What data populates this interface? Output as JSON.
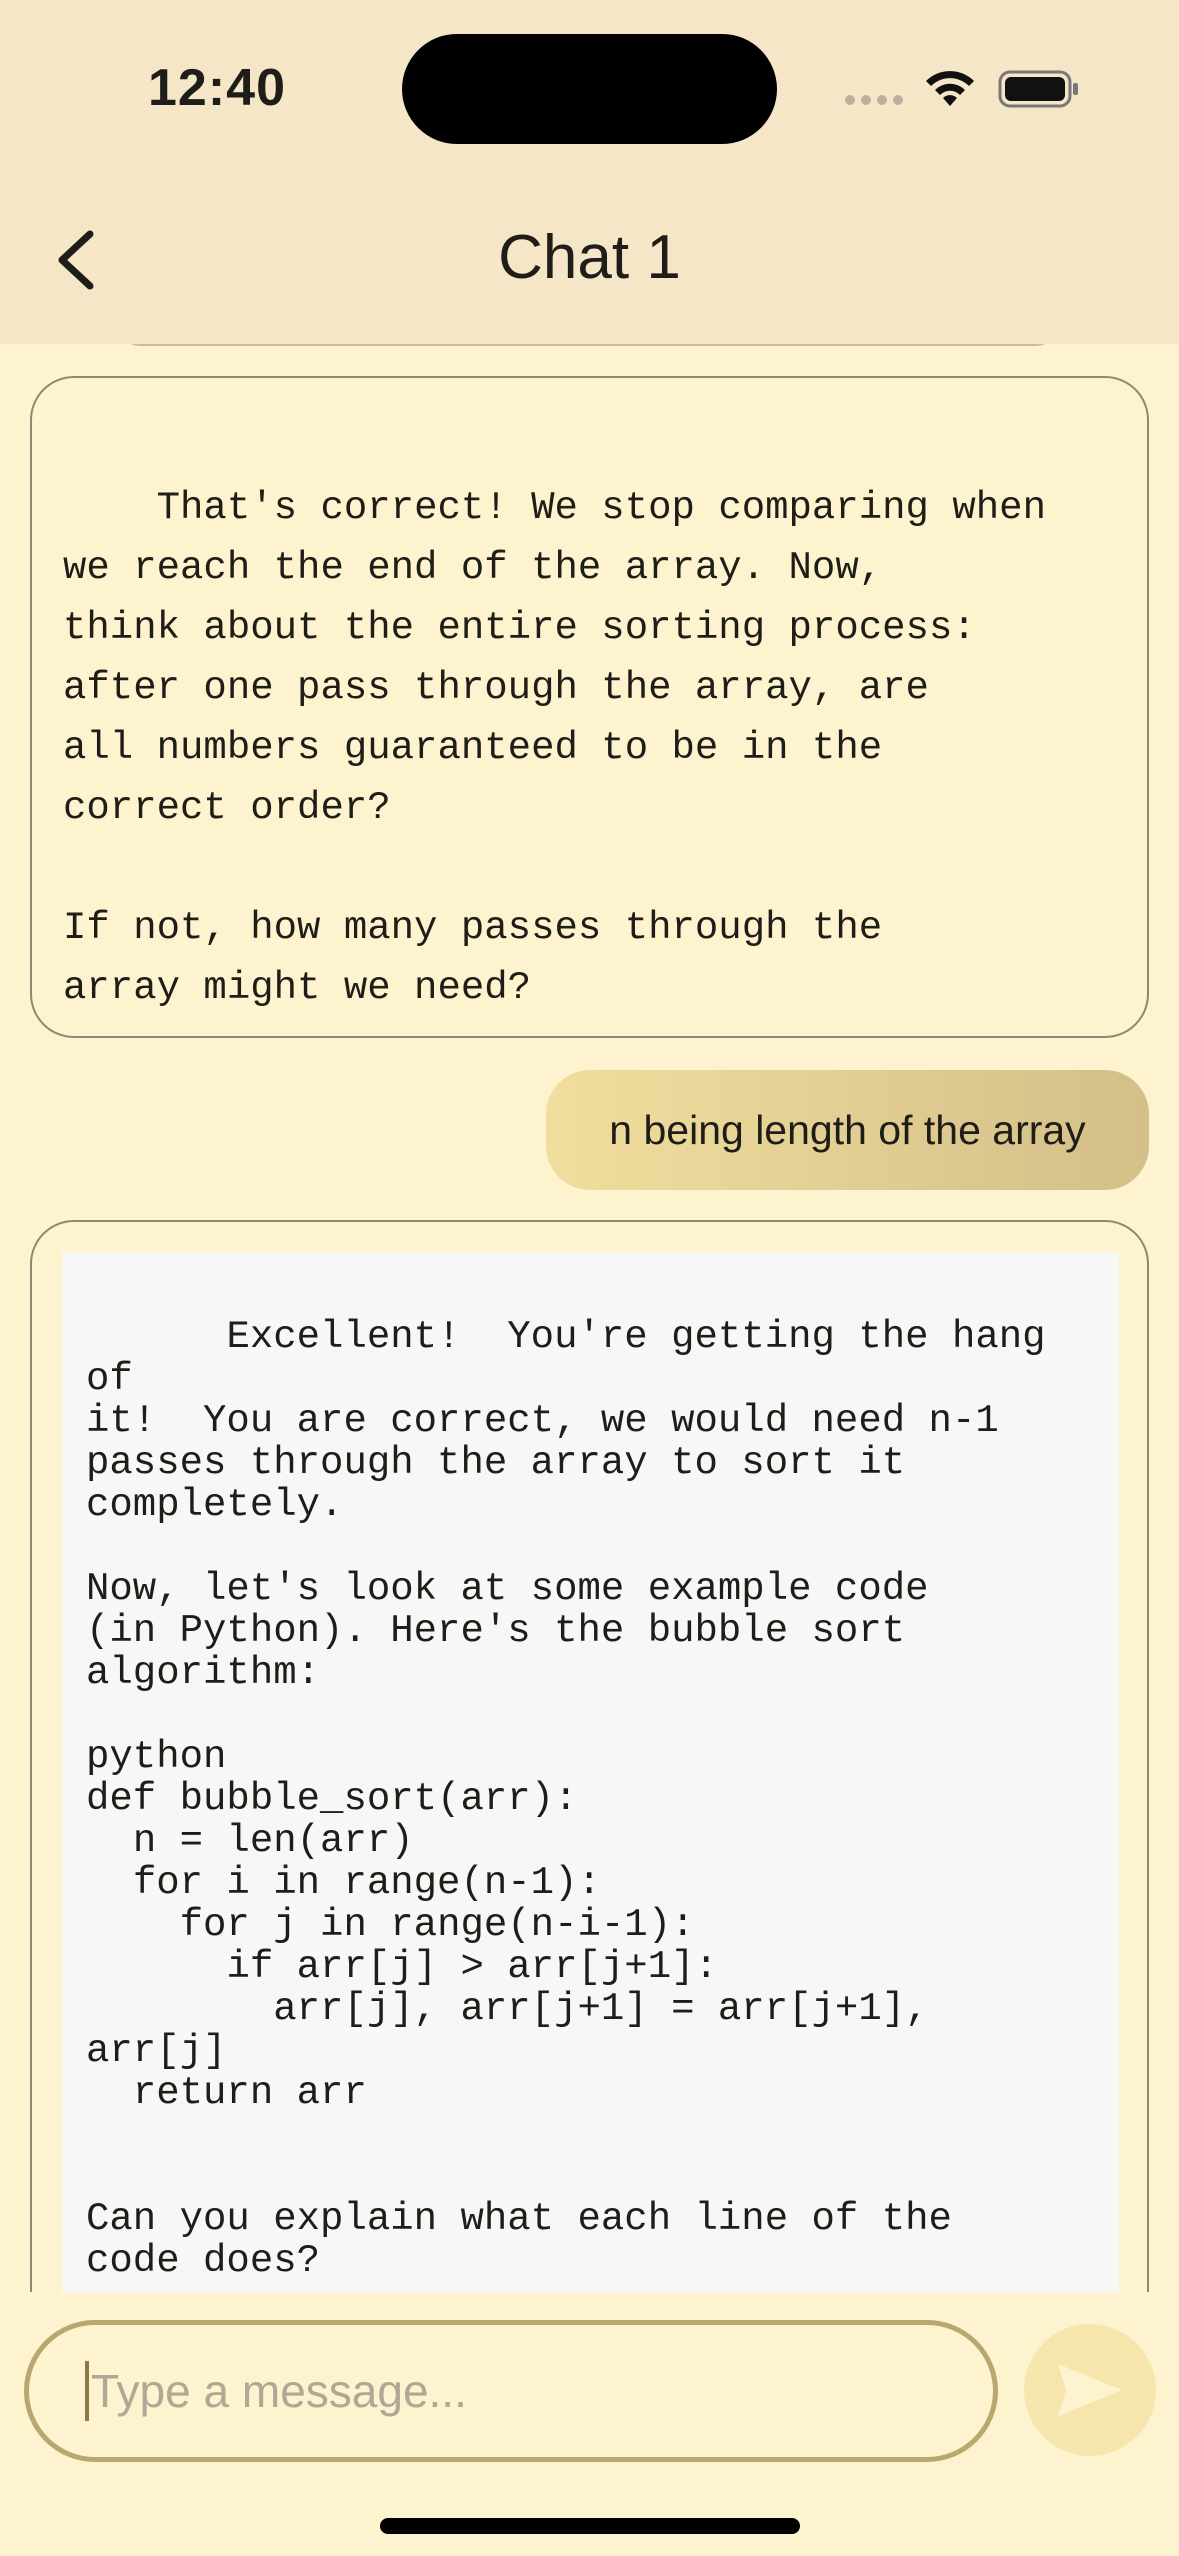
{
  "status_bar": {
    "time": "12:40",
    "icons": [
      "signal-dots-icon",
      "wifi-icon",
      "battery-icon"
    ]
  },
  "header": {
    "back_icon": "chevron-left-icon",
    "title": "Chat 1"
  },
  "messages": [
    {
      "role": "assistant",
      "text": "That's correct! We stop comparing when\nwe reach the end of the array. Now,\nthink about the entire sorting process:\nafter one pass through the array, are\nall numbers guaranteed to be in the\ncorrect order?\n\nIf not, how many passes through the\narray might we need?"
    },
    {
      "role": "user",
      "text": "n being length of the array"
    },
    {
      "role": "assistant",
      "text": "Excellent!  You're getting the hang of\nit!  You are correct, we would need n-1\npasses through the array to sort it\ncompletely.\n\nNow, let's look at some example code\n(in Python). Here's the bubble sort\nalgorithm:\n\npython\ndef bubble_sort(arr):\n  n = len(arr)\n  for i in range(n-1):\n    for j in range(n-i-1):\n      if arr[j] > arr[j+1]:\n        arr[j], arr[j+1] = arr[j+1],\narr[j]\n  return arr\n\n\nCan you explain what each line of the\ncode does?"
    }
  ],
  "composer": {
    "placeholder": "Type a message...",
    "value": "",
    "send_icon": "send-icon"
  },
  "colors": {
    "background": "#fdf3cf",
    "header": "#f4e6c7",
    "user_bubble_start": "#f1de9e",
    "user_bubble_end": "#d3bf88",
    "input_border": "#b9a770",
    "send_button": "#f6e6ad"
  }
}
